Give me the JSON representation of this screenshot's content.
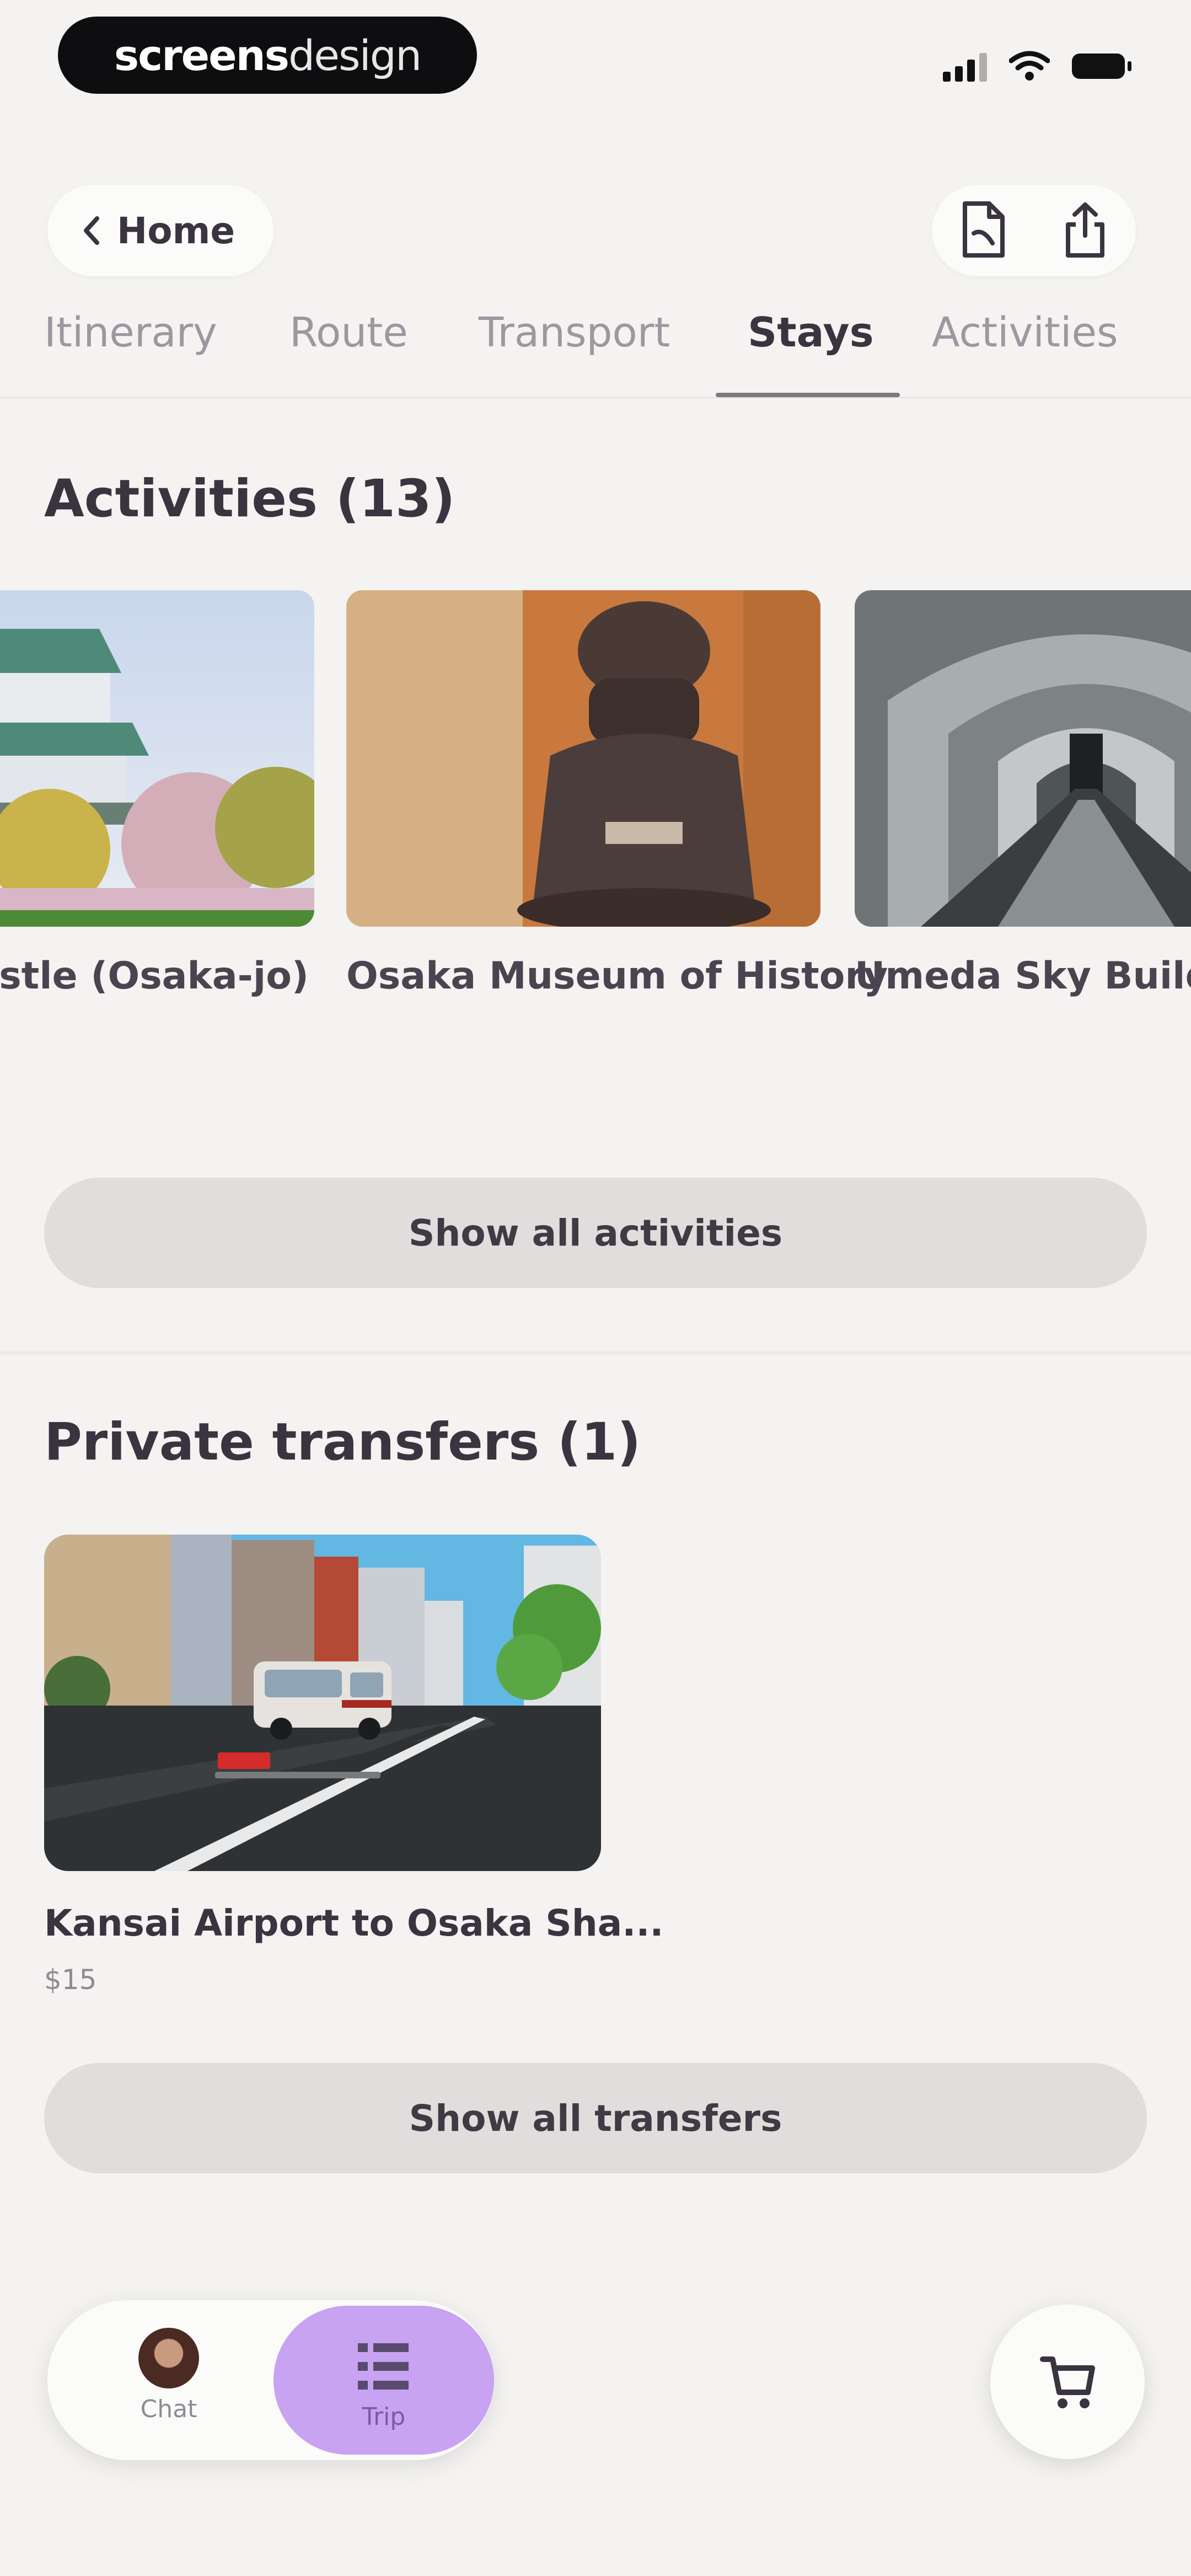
{
  "status_bar": {
    "brand_bold": "screens",
    "brand_light": "design"
  },
  "header": {
    "back_label": "Home",
    "icons": [
      "document-icon",
      "share-icon"
    ]
  },
  "tabs": [
    {
      "label": "Itinerary",
      "active": false
    },
    {
      "label": "Route",
      "active": false
    },
    {
      "label": "Transport",
      "active": false
    },
    {
      "label": "Stays",
      "active": true
    },
    {
      "label": "Activities",
      "active": false
    }
  ],
  "activities": {
    "title": "Activities (13)",
    "items": [
      {
        "name": "astle (Osaka-jo)"
      },
      {
        "name": "Osaka Museum of History"
      },
      {
        "name": "Umeda Sky Buildin"
      }
    ],
    "show_all": "Show all activities"
  },
  "transfers": {
    "title": "Private transfers (1)",
    "items": [
      {
        "name": "Kansai Airport to Osaka Sha...",
        "price": "$15"
      }
    ],
    "show_all": "Show all transfers"
  },
  "bottom_nav": {
    "chat": "Chat",
    "trip": "Trip"
  },
  "colors": {
    "background": "#f4f3f1",
    "accent": "#c7a3f2",
    "text": "#3a3440"
  }
}
